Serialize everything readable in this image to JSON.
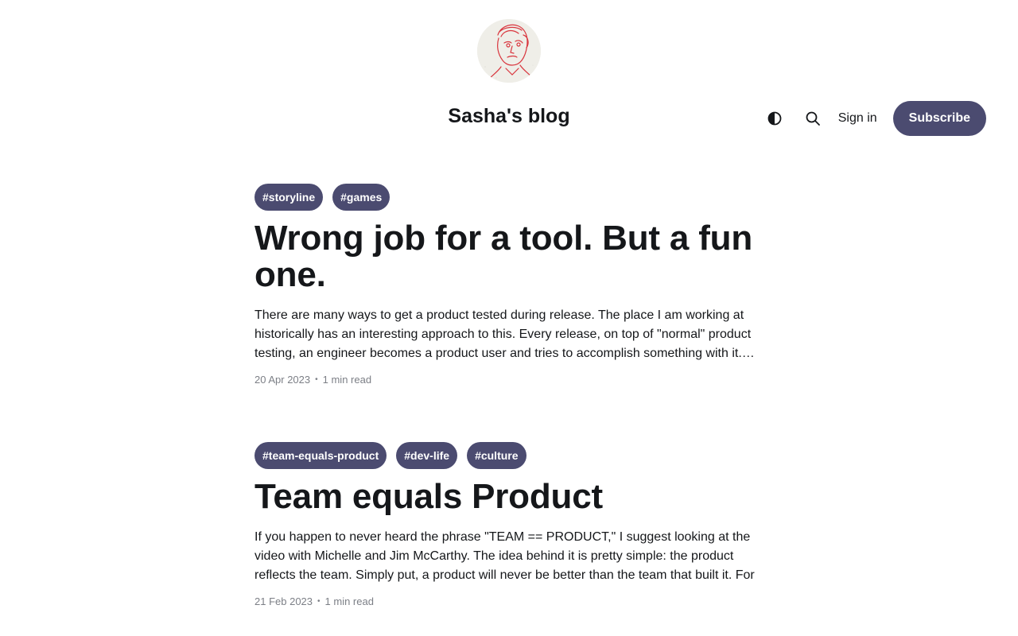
{
  "site": {
    "title": "Sasha's blog"
  },
  "header": {
    "theme_toggle_icon": "contrast-icon",
    "search_icon": "search-icon",
    "sign_in_label": "Sign in",
    "subscribe_label": "Subscribe"
  },
  "colors": {
    "accent": "#4b4b70",
    "text": "#15171a",
    "muted": "#7c7f86"
  },
  "posts": [
    {
      "tags": [
        "#storyline",
        "#games"
      ],
      "title": "Wrong job for a tool. But a fun one.",
      "excerpt": "There are many ways to get a product tested during release. The place I am working at historically has an interesting approach to this. Every release, on top of \"normal\" product testing, an engineer becomes a product user and tries to accomplish something with it. This time",
      "date": "20 Apr 2023",
      "read_time": "1 min read"
    },
    {
      "tags": [
        "#team-equals-product",
        "#dev-life",
        "#culture"
      ],
      "title": "Team equals Product",
      "excerpt": "If you happen to never heard the phrase \"TEAM == PRODUCT,\" I suggest looking at the video with Michelle and Jim McCarthy. The idea behind it is pretty simple: the product reflects the team. Simply put, a product will never be better than the team that built it. For",
      "date": "21 Feb 2023",
      "read_time": "1 min read"
    }
  ]
}
